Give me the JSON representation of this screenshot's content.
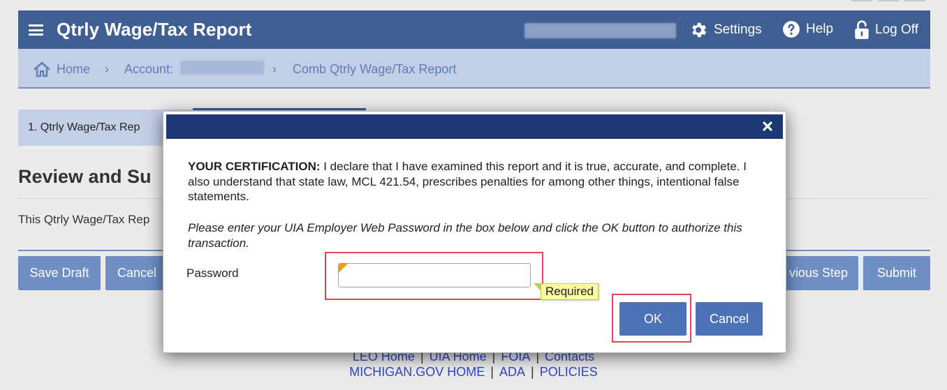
{
  "header": {
    "title": "Qtrly Wage/Tax Report",
    "settings_label": "Settings",
    "help_label": "Help",
    "logoff_label": "Log Off"
  },
  "breadcrumb": {
    "home": "Home",
    "separator": "›",
    "account": "Account:",
    "current": "Comb Qtrly Wage/Tax Report"
  },
  "page": {
    "step_label": "1. Qtrly Wage/Tax Rep",
    "heading": "Review and Su",
    "description": "This Qtrly Wage/Tax Rep",
    "buttons": {
      "save_draft": "Save Draft",
      "cancel": "Cancel",
      "previous_step": "vious Step",
      "submit": "Submit"
    }
  },
  "footer": {
    "row1": [
      "LEO Home",
      "UIA Home",
      "FOIA",
      "Contacts"
    ],
    "row2": [
      "MICHIGAN.GOV HOME",
      "ADA",
      "POLICIES"
    ],
    "divider": "|"
  },
  "modal": {
    "close_symbol": "×",
    "cert_bold": "YOUR CERTIFICATION:",
    "cert_text": " I declare that I have examined this report and it is true, accurate, and complete. I also understand that state law, MCL 421.54, prescribes penalties for among other things, intentional false statements.",
    "instructions": "Please enter your UIA Employer Web Password in the box below and click the OK button to authorize this transaction.",
    "password_label": "Password",
    "password_value": "",
    "required_tooltip": "Required",
    "ok_label": "OK",
    "cancel_label": "Cancel"
  },
  "colors": {
    "header_bg": "#3f5e91",
    "breadcrumb_bg": "#c3cfe6",
    "modal_header_bg": "#1c3773",
    "button_bg": "#4d71b6",
    "page_button_bg": "#6f8fc4",
    "highlight": "#e0474e",
    "tooltip_bg": "#fbfba4",
    "link": "#2f46c8"
  },
  "icons": [
    "hamburger-icon",
    "gear-icon",
    "help-icon",
    "lock-icon",
    "home-icon",
    "close-icon"
  ]
}
